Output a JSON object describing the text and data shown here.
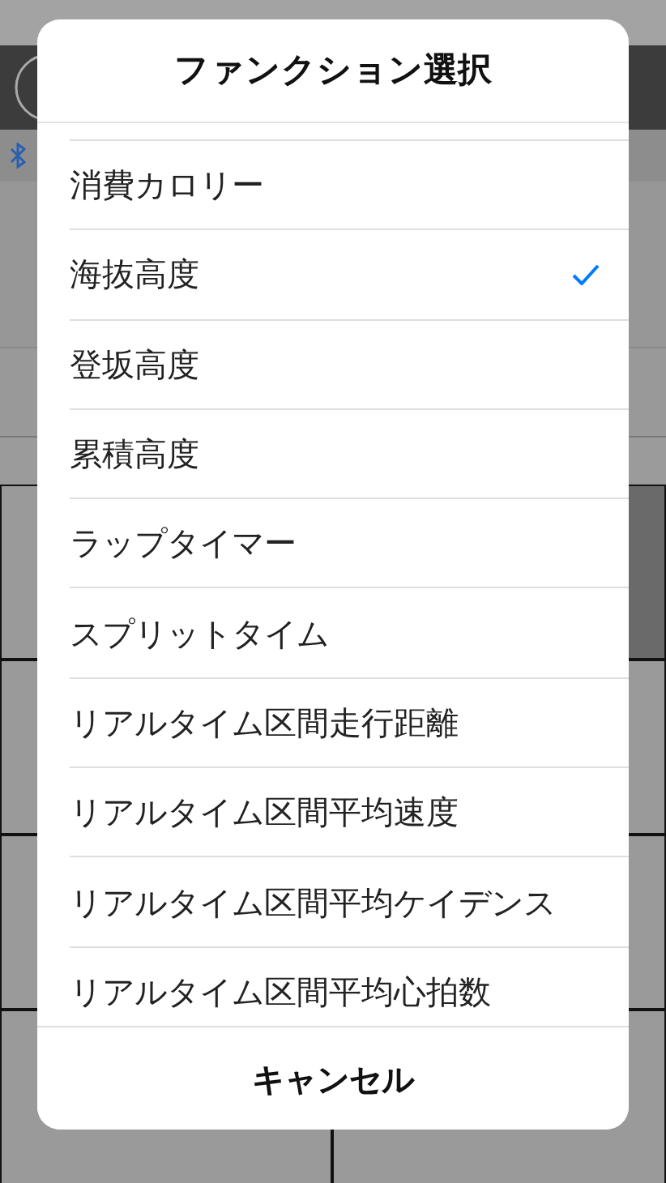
{
  "dialog": {
    "title": "ファンクション選択",
    "items": [
      {
        "label": "消費カロリー",
        "selected": false
      },
      {
        "label": "海抜高度",
        "selected": true
      },
      {
        "label": "登坂高度",
        "selected": false
      },
      {
        "label": "累積高度",
        "selected": false
      },
      {
        "label": "ラップタイマー",
        "selected": false
      },
      {
        "label": "スプリットタイム",
        "selected": false
      },
      {
        "label": "リアルタイム区間走行距離",
        "selected": false
      },
      {
        "label": "リアルタイム区間平均速度",
        "selected": false
      },
      {
        "label": "リアルタイム区間平均ケイデンス",
        "selected": false
      },
      {
        "label": "リアルタイム区間平均心拍数",
        "selected": false
      }
    ],
    "cancel": "キャンセル"
  }
}
